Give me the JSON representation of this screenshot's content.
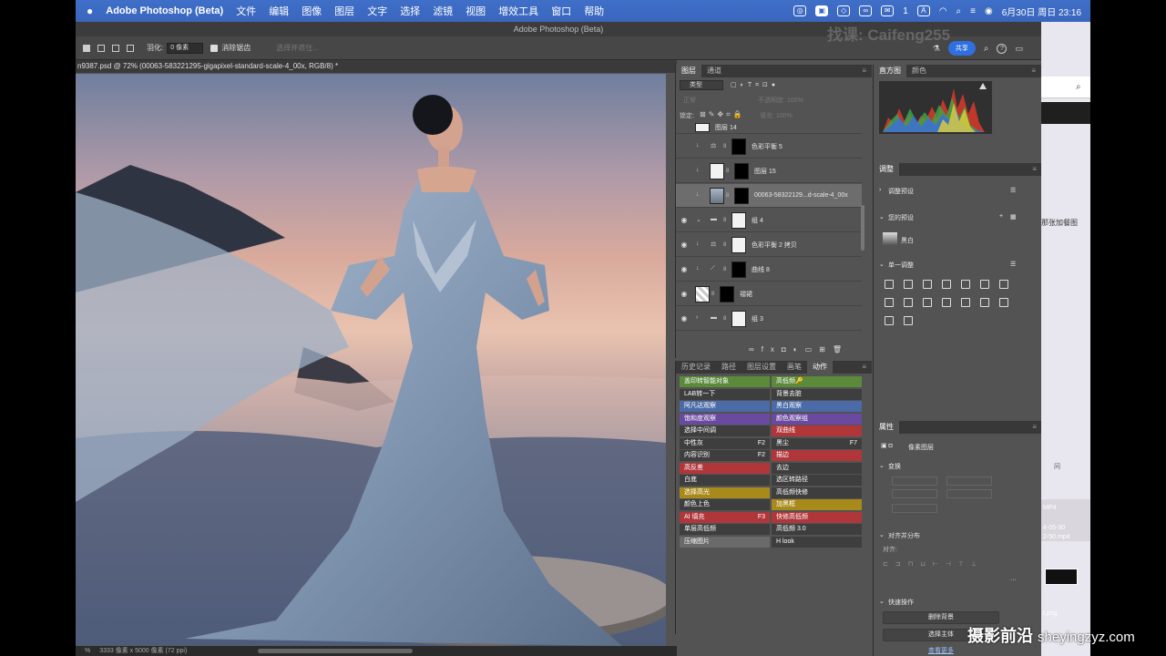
{
  "menubar": {
    "app": "Adobe Photoshop (Beta)",
    "items": [
      "文件",
      "编辑",
      "图像",
      "图层",
      "文字",
      "选择",
      "滤镜",
      "视图",
      "增效工具",
      "窗口",
      "帮助"
    ],
    "clock": "6月30日 周日 23:16",
    "badge": "1"
  },
  "window_title": "Adobe Photoshop (Beta)",
  "options": {
    "feather_label": "羽化:",
    "feather_value": "0 像素",
    "antialias_label": "消除锯齿",
    "select_mask": "选择并遮住...",
    "share": "共享"
  },
  "watermark_top": "找课: Caifeng255",
  "document_tab": "n9387.psd @ 72% (00063-583221295-gigapixel-standard-scale-4_00x, RGB/8) *",
  "status": "3333 像素 x 5000 像素 (72 ppi)",
  "zoom": "%",
  "layers": {
    "tabs": [
      "图层",
      "通道"
    ],
    "filter_kind": "类型",
    "mode": "正常",
    "opacity": "不透明度: 100%",
    "lock": "锁定:",
    "fill": "填充: 100%",
    "rows": [
      {
        "name": "图层 14"
      },
      {
        "name": "色彩平衡 5"
      },
      {
        "name": "图层 15"
      },
      {
        "name": "00063-58322129...d-scale-4_00x"
      },
      {
        "name": "组 4"
      },
      {
        "name": "色彩平衡 2 拷贝"
      },
      {
        "name": "曲线 8"
      },
      {
        "name": "褶裙"
      },
      {
        "name": "组 3"
      }
    ]
  },
  "actions": {
    "tabs": [
      "历史记录",
      "路径",
      "图层设置",
      "画笔",
      "动作"
    ],
    "items": [
      {
        "label": "盖印转智能对象",
        "key": "",
        "color": "#5a8a3a"
      },
      {
        "label": "高低频🔑",
        "key": "",
        "color": "#5a8a3a"
      },
      {
        "label": "LAB转一下",
        "key": "",
        "color": "#3e3e3e"
      },
      {
        "label": "背景去脏",
        "key": "",
        "color": "#3e3e3e"
      },
      {
        "label": "阿凡达观察",
        "key": "",
        "color": "#4a6aa8"
      },
      {
        "label": "黑白观察",
        "key": "",
        "color": "#4a6aa8"
      },
      {
        "label": "饱和度观察",
        "key": "",
        "color": "#6a4aa0"
      },
      {
        "label": "颜色观察组",
        "key": "",
        "color": "#6a4aa0"
      },
      {
        "label": "选择中间调",
        "key": "",
        "color": "#3e3e3e"
      },
      {
        "label": "双曲线",
        "key": "",
        "color": "#b0363a"
      },
      {
        "label": "中性灰",
        "key": "F2",
        "color": "#3e3e3e"
      },
      {
        "label": "黑尘",
        "key": "F7",
        "color": "#3e3e3e"
      },
      {
        "label": "内容识别",
        "key": "F2",
        "color": "#3e3e3e"
      },
      {
        "label": "描边",
        "key": "",
        "color": "#b0363a"
      },
      {
        "label": "高反差",
        "key": "",
        "color": "#b0363a"
      },
      {
        "label": "去边",
        "key": "",
        "color": "#3e3e3e"
      },
      {
        "label": "白底",
        "key": "",
        "color": "#3e3e3e"
      },
      {
        "label": "选区转路径",
        "key": "",
        "color": "#3e3e3e"
      },
      {
        "label": "选择高光",
        "key": "",
        "color": "#a88a1a"
      },
      {
        "label": "高低频快修",
        "key": "",
        "color": "#3e3e3e"
      },
      {
        "label": "颜色上色",
        "key": "",
        "color": "#3e3e3e"
      },
      {
        "label": "加黑框",
        "key": "",
        "color": "#a88a1a"
      },
      {
        "label": "AI 填充",
        "key": "F3",
        "color": "#b0363a"
      },
      {
        "label": "快修高低频",
        "key": "",
        "color": "#b0363a"
      },
      {
        "label": "单层高低频",
        "key": "",
        "color": "#3e3e3e"
      },
      {
        "label": "高低频 3.0",
        "key": "",
        "color": "#3e3e3e"
      },
      {
        "label": "压缩图片",
        "key": "",
        "color": "#6a6a6a"
      },
      {
        "label": "H look",
        "key": "",
        "color": "#3e3e3e"
      }
    ]
  },
  "histogram": {
    "tabs": [
      "直方图",
      "颜色"
    ]
  },
  "adjustments": {
    "title": "调整",
    "presets": "调整预设",
    "your_presets": "您的预设",
    "bw": "黑白",
    "single": "单一调整"
  },
  "properties": {
    "title": "属性",
    "pixel_layer": "像素图层",
    "transform": "变换",
    "align": "对齐并分布",
    "align_to": "对齐:",
    "quick": "快速操作",
    "remove_bg": "删除背景",
    "select_subject": "选择主体",
    "more": "查看更多"
  },
  "background_window": {
    "text1": "那张加餐图",
    "text2": "MP4",
    "text3": "4-05-30",
    "text4": "2-50.mp4",
    "text5": "t.png",
    "text6": "问"
  },
  "watermark_bottom": {
    "cn": "摄影前沿",
    "url": "sheyingzyz.com"
  }
}
